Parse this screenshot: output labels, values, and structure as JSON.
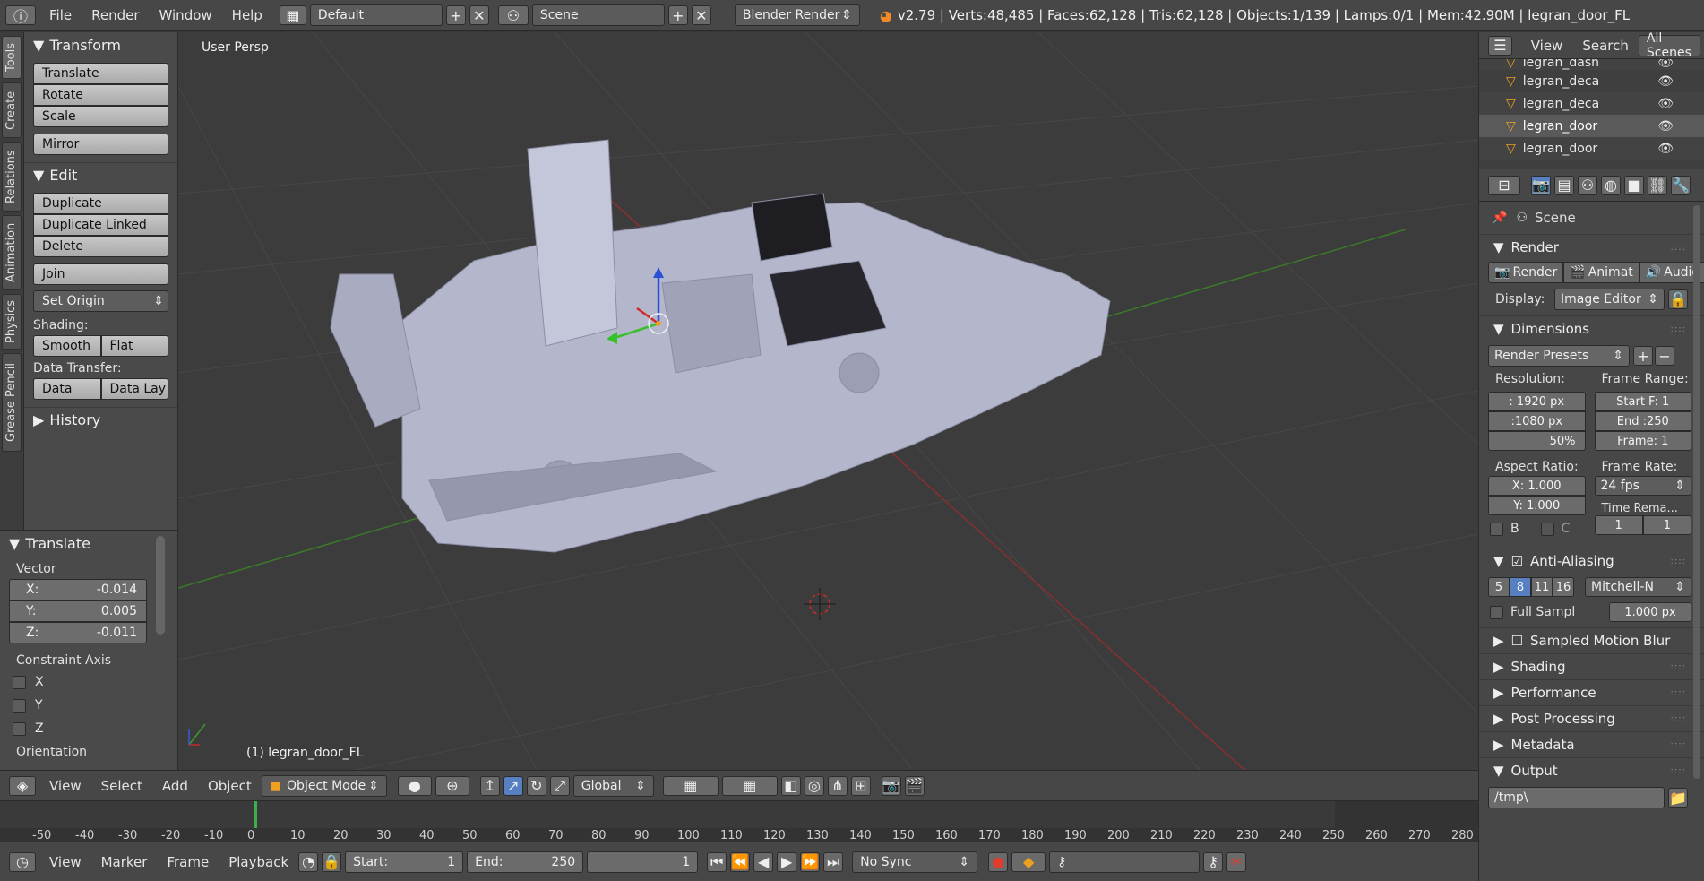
{
  "topbar": {
    "menus": [
      "File",
      "Render",
      "Window",
      "Help"
    ],
    "layout": "Default",
    "scene": "Scene",
    "engine": "Blender Render",
    "stats": "v2.79 | Verts:48,485 | Faces:62,128 | Tris:62,128 | Objects:1/139 | Lamps:0/1 | Mem:42.90M | legran_door_FL"
  },
  "lefttabs": [
    "Tools",
    "Create",
    "Relations",
    "Animation",
    "Physics",
    "Grease Pencil"
  ],
  "tools": {
    "transform_header": "Transform",
    "translate": "Translate",
    "rotate": "Rotate",
    "scale": "Scale",
    "mirror": "Mirror",
    "edit_header": "Edit",
    "duplicate": "Duplicate",
    "duplicate_linked": "Duplicate Linked",
    "delete": "Delete",
    "join": "Join",
    "set_origin": "Set Origin",
    "shading_label": "Shading:",
    "smooth": "Smooth",
    "flat": "Flat",
    "data_transfer_label": "Data Transfer:",
    "data": "Data",
    "data_lay": "Data Lay",
    "history_header": "History"
  },
  "operator": {
    "header": "Translate",
    "vector_label": "Vector",
    "x_label": "X:",
    "x": "-0.014",
    "y_label": "Y:",
    "y": "0.005",
    "z_label": "Z:",
    "z": "-0.011",
    "constraint_label": "Constraint Axis",
    "axes": [
      "X",
      "Y",
      "Z"
    ],
    "orientation_label": "Orientation"
  },
  "viewport": {
    "title": "User Persp",
    "object_label": "(1) legran_door_FL"
  },
  "view_header": {
    "view": "View",
    "select": "Select",
    "add": "Add",
    "object": "Object",
    "mode": "Object Mode",
    "orientation": "Global"
  },
  "timeline": {
    "ticks": [
      "-50",
      "-40",
      "-30",
      "-20",
      "-10",
      "0",
      "10",
      "20",
      "30",
      "40",
      "50",
      "60",
      "70",
      "80",
      "90",
      "100",
      "110",
      "120",
      "130",
      "140",
      "150",
      "160",
      "170",
      "180",
      "190",
      "200",
      "210",
      "220",
      "230",
      "240",
      "250",
      "260",
      "270",
      "280"
    ]
  },
  "time_header": {
    "view": "View",
    "marker": "Marker",
    "frame": "Frame",
    "playback": "Playback",
    "start_label": "Start:",
    "start": "1",
    "end_label": "End:",
    "end": "250",
    "current": "1",
    "sync": "No Sync"
  },
  "outliner": {
    "view": "View",
    "search": "Search",
    "filter": "All Scenes",
    "rows": [
      "legran_dash",
      "legran_deca",
      "legran_deca",
      "legran_door",
      "legran_door"
    ]
  },
  "properties": {
    "scene": "Scene",
    "render_header": "Render",
    "render_btn": "Render",
    "animation_btn": "Animat",
    "audio_btn": "Audio",
    "display_label": "Display:",
    "display_value": "Image Editor",
    "dimensions_header": "Dimensions",
    "presets": "Render Presets",
    "resolution_label": "Resolution:",
    "res_x": ": 1920 px",
    "res_y": ":1080 px",
    "res_pct": "50%",
    "frame_range_label": "Frame Range:",
    "start_f": "Start F: 1",
    "end_f": "End :250",
    "frame": "Frame: 1",
    "aspect_label": "Aspect Ratio:",
    "aspect_x": "X:  1.000",
    "aspect_y": "Y:  1.000",
    "frame_rate_label": "Frame Rate:",
    "fps": "24 fps",
    "time_remap_label": "Time Rema...",
    "remap_a": "1",
    "remap_b": "1",
    "b_label": "B",
    "c_label": "C",
    "aa_header": "Anti-Aliasing",
    "aa_samples": [
      "5",
      "8",
      "11",
      "16"
    ],
    "aa_filter": "Mitchell-N",
    "full_sample": "Full Sampl",
    "filter_size": "1.000 px",
    "motion_blur": "Sampled Motion Blur",
    "shading": "Shading",
    "performance": "Performance",
    "post": "Post Processing",
    "metadata": "Metadata",
    "output": "Output",
    "output_path": "/tmp\\"
  },
  "colors": {
    "accent": "#5680c2",
    "grid": "#474747",
    "x_axis": "#8a2f2f",
    "y_axis": "#3a7a2a",
    "car": "#b4b6cc"
  }
}
